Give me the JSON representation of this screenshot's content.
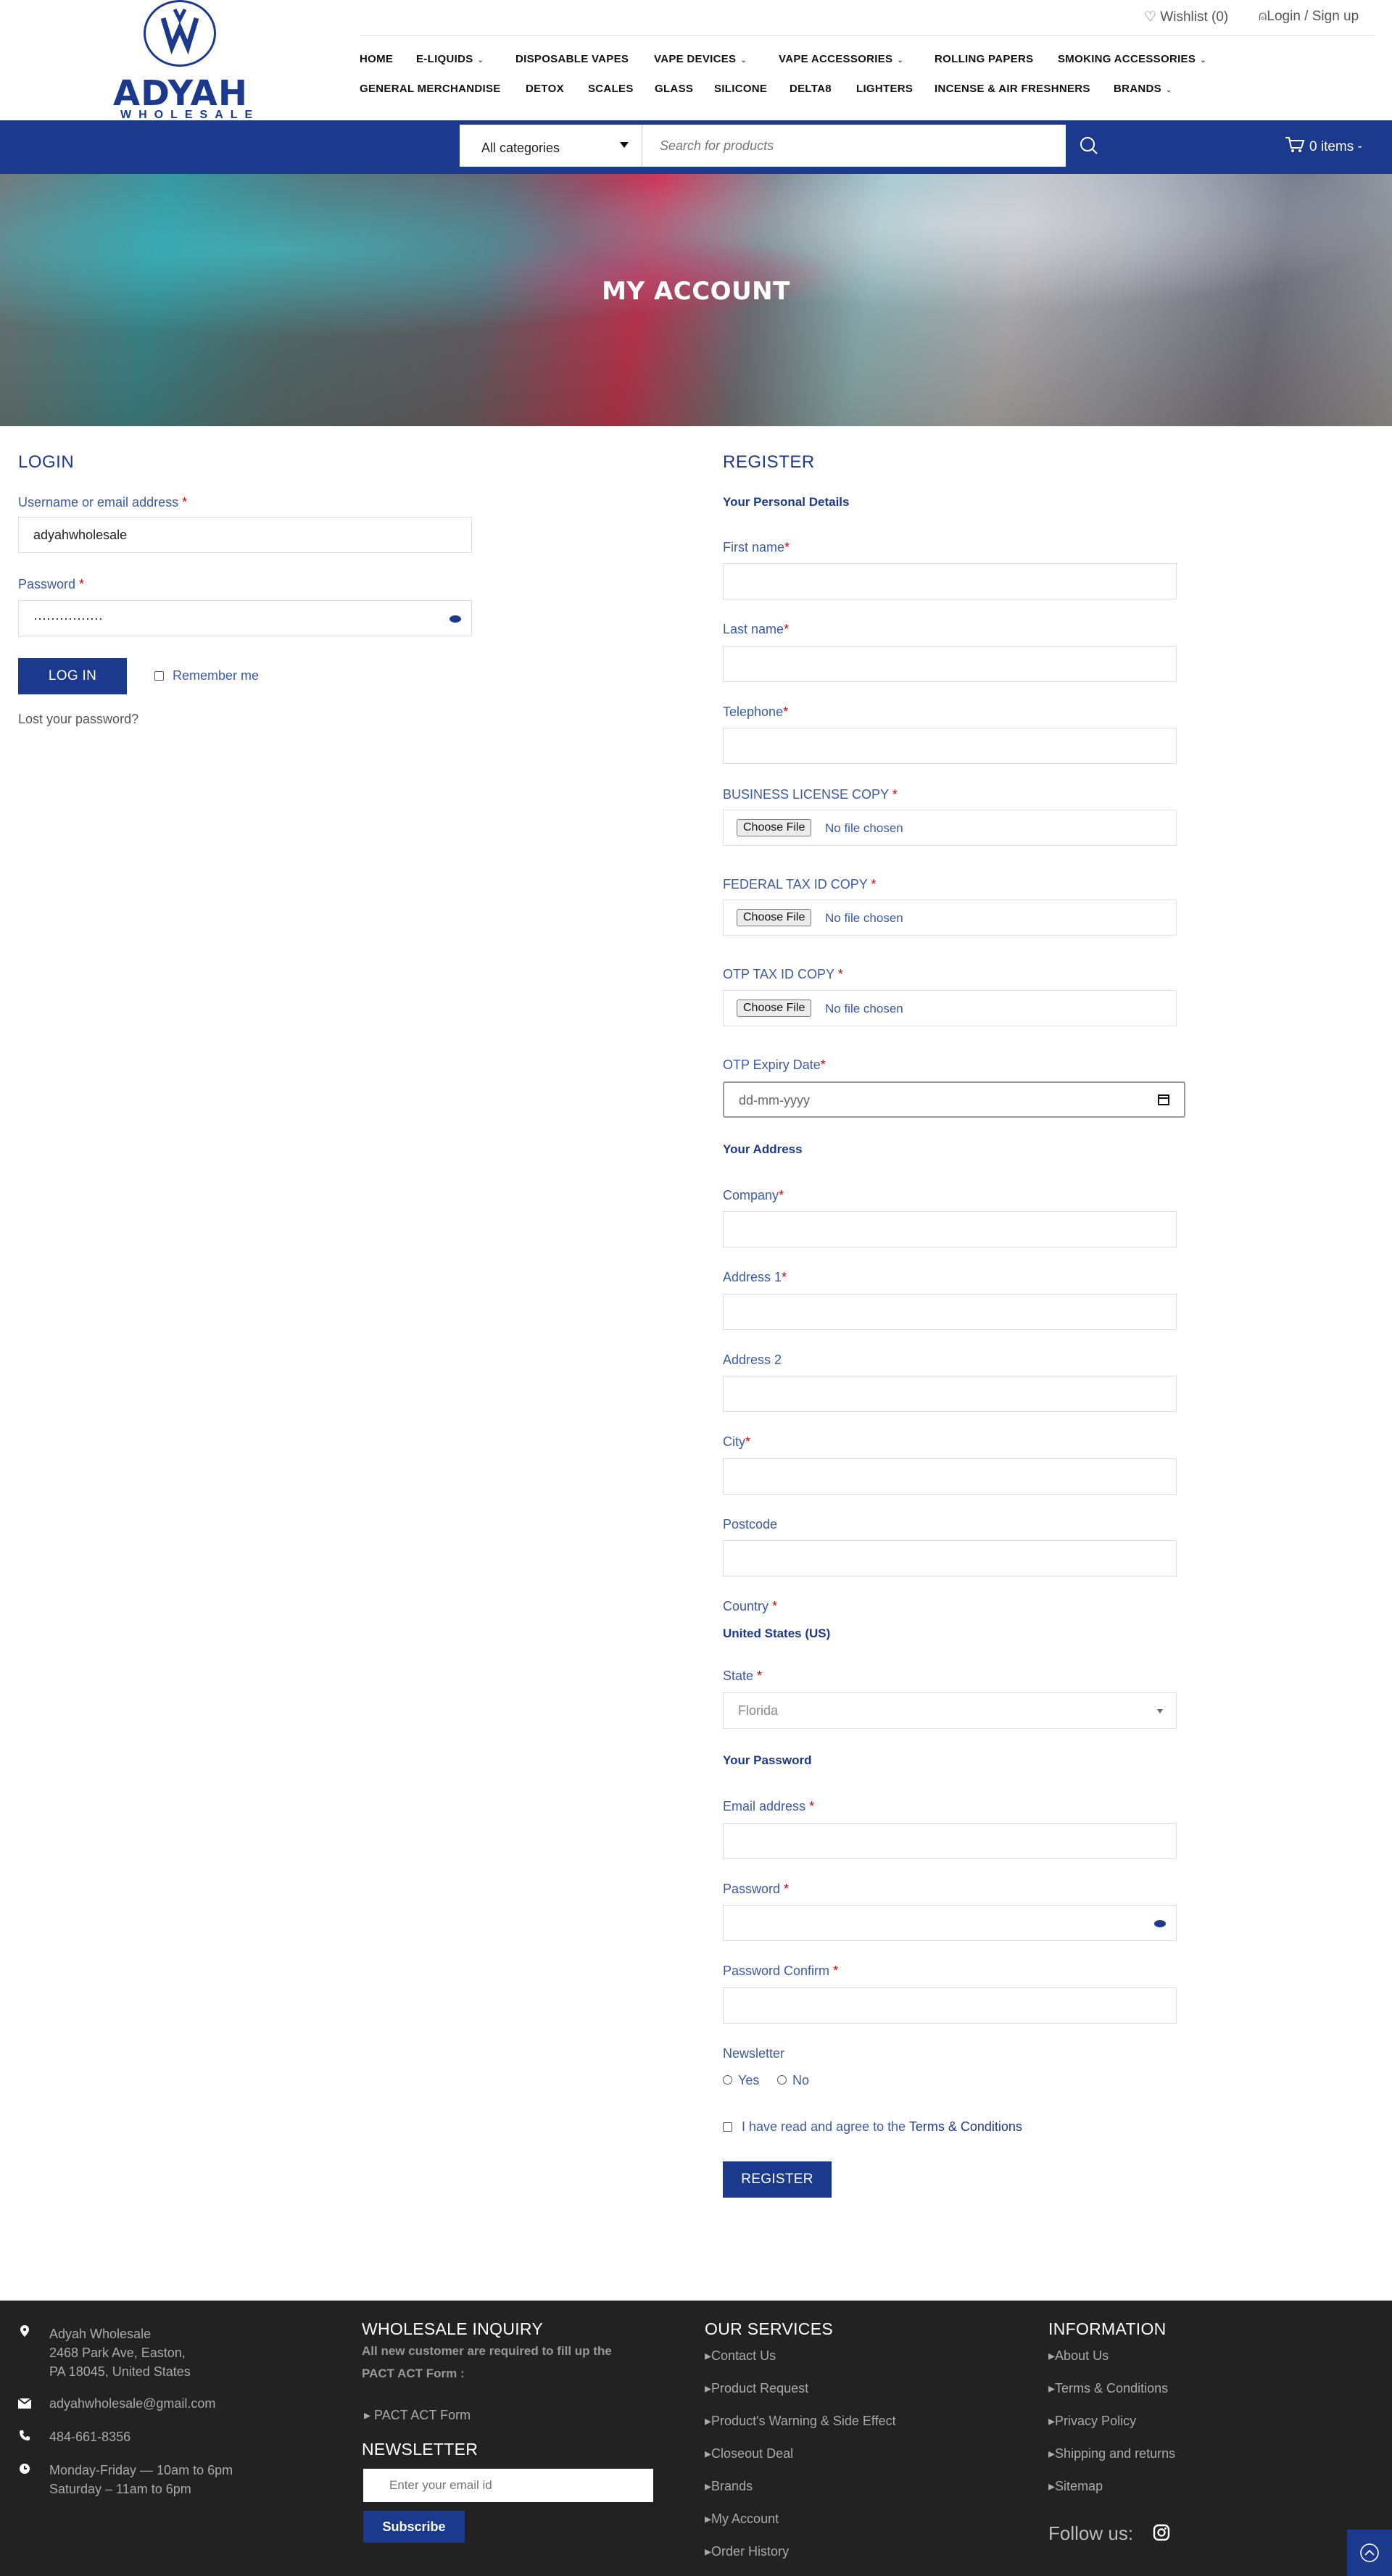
{
  "header": {
    "logo_text": "ADYAH",
    "logo_sub": "WHOLESALE",
    "wishlist": "♡ Wishlist (0)",
    "login_signup": "Login / Sign up",
    "nav_row1": [
      "HOME",
      "E-LIQUIDS",
      "DISPOSABLE VAPES",
      "VAPE DEVICES",
      "VAPE ACCESSORIES",
      "ROLLING PAPERS",
      "SMOKING ACCESSORIES"
    ],
    "nav_row2": [
      "GENERAL MERCHANDISE",
      "DETOX",
      "SCALES",
      "GLASS",
      "SILICONE",
      "DELTA8",
      "LIGHTERS",
      "INCENSE & AIR FRESHNERS",
      "BRANDS"
    ]
  },
  "search": {
    "category": "All categories",
    "placeholder": "Search for products",
    "cart": "0 items -"
  },
  "banner": {
    "title": "MY ACCOUNT"
  },
  "login": {
    "title": "LOGIN",
    "username_label": "Username or email address",
    "username_value": "adyahwholesale",
    "password_label": "Password",
    "password_value": "················",
    "button": "LOG IN",
    "remember": "Remember me",
    "lost": "Lost your password?"
  },
  "register": {
    "title": "REGISTER",
    "personal_details": "Your Personal Details",
    "first_name": "First name",
    "last_name": "Last name",
    "telephone": "Telephone",
    "business_license": "BUSINESS LICENSE COPY",
    "federal_tax": "FEDERAL TAX ID COPY",
    "otp_tax": "OTP TAX ID COPY",
    "choose_file": "Choose File",
    "no_file": "No file chosen",
    "otp_expiry": "OTP Expiry Date",
    "date_placeholder": "dd-mm-yyyy",
    "your_address": "Your Address",
    "company": "Company",
    "address1": "Address 1",
    "address2": "Address 2",
    "city": "City",
    "postcode": "Postcode",
    "country": "Country",
    "country_value": "United States (US)",
    "state": "State",
    "state_value": "Florida",
    "your_password": "Your Password",
    "email": "Email address",
    "password": "Password",
    "password_confirm": "Password Confirm",
    "newsletter": "Newsletter",
    "yes": "Yes",
    "no": "No",
    "agree_prefix": "I have read and agree to the",
    "agree_link": "Terms & Conditions",
    "button": "REGISTER"
  },
  "footer": {
    "address_line1": "Adyah Wholesale",
    "address_line2": "2468 Park Ave, Easton,",
    "address_line3": "PA 18045, United States",
    "email": "adyahwholesale@gmail.com",
    "phone": "484-661-8356",
    "hours1": "Monday-Friday — 10am to 6pm",
    "hours2": "Saturday – 11am to 6pm",
    "wholesale_title": "WHOLESALE INQUIRY",
    "wholesale_text1": "All new customer are required to fill up the",
    "wholesale_text2": "PACT ACT Form :",
    "pact_link": "PACT ACT Form",
    "newsletter_title": "NEWSLETTER",
    "newsletter_placeholder": "Enter your email id",
    "subscribe": "Subscribe",
    "services_title": "OUR SERVICES",
    "services": [
      "Contact Us",
      "Product Request",
      "Product's Warning & Side Effect",
      "Closeout Deal",
      "Brands",
      "My Account",
      "Order History"
    ],
    "info_title": "INFORMATION",
    "info": [
      "About Us",
      "Terms & Conditions",
      "Privacy Policy",
      "Shipping and returns",
      "Sitemap"
    ],
    "follow": "Follow us:"
  },
  "colors": {
    "brand": "#1b3a8e",
    "footer_bg": "#222222",
    "required": "#dd0000"
  }
}
